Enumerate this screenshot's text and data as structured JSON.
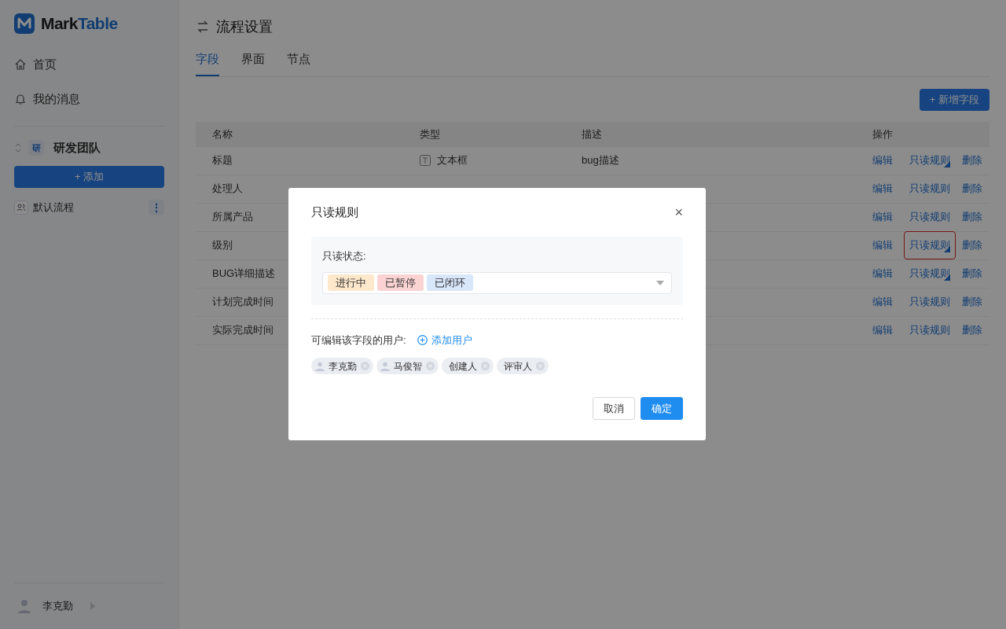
{
  "brand": {
    "name_dark": "Mark",
    "name_blue": "Table"
  },
  "sidebar": {
    "nav": [
      {
        "label": "首页",
        "kind": "home"
      },
      {
        "label": "我的消息",
        "kind": "bell"
      }
    ],
    "team": {
      "badge": "研",
      "name": "研发团队"
    },
    "add_button": "+ 添加",
    "flows": [
      {
        "label": "默认流程",
        "more": "⋮"
      }
    ],
    "user": {
      "name": "李克勤"
    }
  },
  "page": {
    "title": "流程设置",
    "tabs": [
      {
        "label": "字段",
        "selected": true
      },
      {
        "label": "界面",
        "selected": false
      },
      {
        "label": "节点",
        "selected": false
      }
    ],
    "add_field_button": "+ 新增字段",
    "table": {
      "columns": [
        "名称",
        "类型",
        "描述",
        "操作"
      ],
      "rows": [
        {
          "name": "标题",
          "kind": "text",
          "type": "文本框",
          "description": "bug描述",
          "actions": [
            "编辑",
            "只读规则",
            "删除"
          ],
          "has_rule": true,
          "highlighted": false
        },
        {
          "name": "处理人",
          "actions": [
            "编辑",
            "只读规则",
            "删除"
          ],
          "has_rule": false,
          "highlighted": false
        },
        {
          "name": "所属产品",
          "actions": [
            "编辑",
            "只读规则",
            "删除"
          ],
          "has_rule": false,
          "highlighted": false
        },
        {
          "name": "级别",
          "actions": [
            "编辑",
            "只读规则",
            "删除"
          ],
          "has_rule": true,
          "highlighted": true
        },
        {
          "name": "BUG详细描述",
          "actions": [
            "编辑",
            "只读规则",
            "删除"
          ],
          "has_rule": true,
          "highlighted": false
        },
        {
          "name": "计划完成时间",
          "actions": [
            "编辑",
            "只读规则",
            "删除"
          ],
          "has_rule": false,
          "highlighted": false
        },
        {
          "name": "实际完成时间",
          "actions": [
            "编辑",
            "只读规则",
            "删除"
          ],
          "has_rule": false,
          "highlighted": false
        }
      ]
    }
  },
  "dialog": {
    "title": "只读规则",
    "close": "×",
    "status_label": "只读状态:",
    "statuses": [
      {
        "label": "进行中",
        "color": "#fde8cc"
      },
      {
        "label": "已暂停",
        "color": "#fbd3d3"
      },
      {
        "label": "已闭环",
        "color": "#d9e7fb"
      }
    ],
    "users_label": "可编辑该字段的用户:",
    "add_user": "添加用户",
    "users": [
      {
        "label": "李克勤",
        "kind": "person"
      },
      {
        "label": "马俊智",
        "kind": "person"
      },
      {
        "label": "创建人",
        "kind": "role"
      },
      {
        "label": "评审人",
        "kind": "role"
      }
    ],
    "buttons": [
      {
        "label": "取消",
        "kind": "secondary"
      },
      {
        "label": "确定",
        "kind": "primary"
      }
    ]
  }
}
